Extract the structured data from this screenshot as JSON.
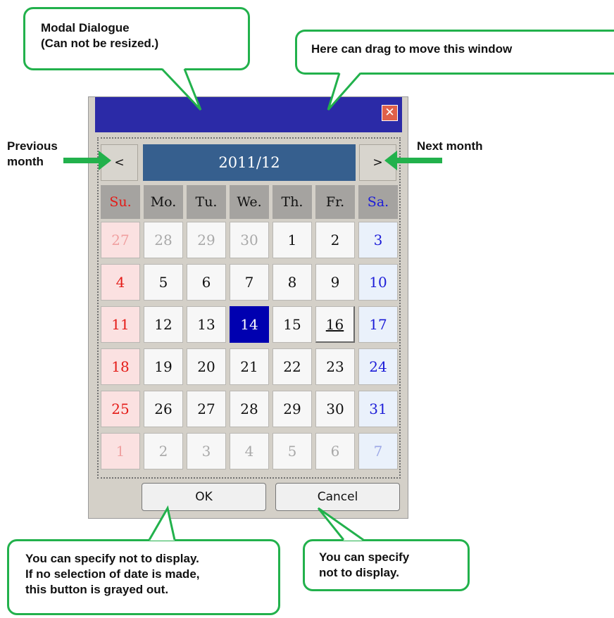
{
  "callouts": {
    "modal": "Modal Dialogue\n(Can not be resized.)",
    "drag": "Here can drag to move this window",
    "previous": "Previous\nmonth",
    "next": "Next month",
    "ok_note": "You can specify not to display.\nIf no selection of date is made,\nthis button is grayed out.",
    "cancel_note": "You can specify\nnot to display."
  },
  "dialog": {
    "close_icon": "close-icon",
    "prev_label": "<",
    "next_label": ">",
    "month_label": "2011/12",
    "weekdays": [
      "Su.",
      "Mo.",
      "Tu.",
      "We.",
      "Th.",
      "Fr.",
      "Sa."
    ],
    "weeks": [
      [
        "27",
        "28",
        "29",
        "30",
        "1",
        "2",
        "3"
      ],
      [
        "4",
        "5",
        "6",
        "7",
        "8",
        "9",
        "10"
      ],
      [
        "11",
        "12",
        "13",
        "14",
        "15",
        "16",
        "17"
      ],
      [
        "18",
        "19",
        "20",
        "21",
        "22",
        "23",
        "24"
      ],
      [
        "25",
        "26",
        "27",
        "28",
        "29",
        "30",
        "31"
      ],
      [
        "1",
        "2",
        "3",
        "4",
        "5",
        "6",
        "7"
      ]
    ],
    "other_month_weeks": [
      0,
      5
    ],
    "other_month_days_week0": [
      "27",
      "28",
      "29",
      "30"
    ],
    "selected_day": "14",
    "today_day": "16",
    "ok_label": "OK",
    "cancel_label": "Cancel"
  },
  "colors": {
    "callout_border": "#22b14c",
    "titlebar": "#2b2aa7",
    "month_header": "#365f8e",
    "sunday": "#e41b17",
    "saturday": "#1c1cd8",
    "selected": "#0000b0"
  }
}
